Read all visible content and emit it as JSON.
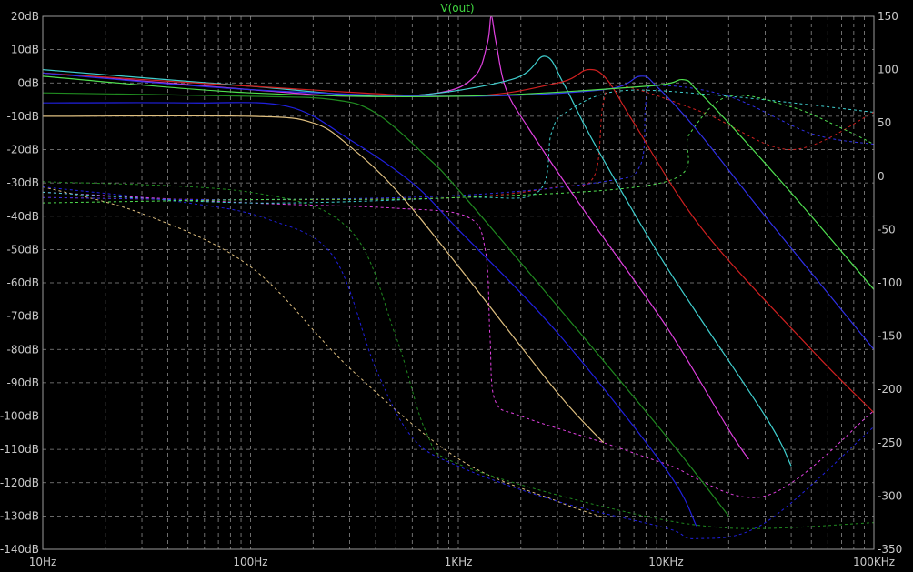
{
  "chart_data": {
    "type": "line",
    "title": "V(out)",
    "title_color": "#40d840",
    "background": "#000000",
    "grid": true,
    "grid_color": "#8a8a8a",
    "x_scale": "log",
    "xlim": [
      10,
      100000
    ],
    "x_ticks": [
      {
        "value": 10,
        "label": "10Hz"
      },
      {
        "value": 100,
        "label": "100Hz"
      },
      {
        "value": 1000,
        "label": "1KHz"
      },
      {
        "value": 10000,
        "label": "10KHz"
      },
      {
        "value": 100000,
        "label": "100KHz"
      }
    ],
    "ylim_left": [
      -140,
      20
    ],
    "left_unit": "dB",
    "y_ticks_left": [
      "20dB",
      "10dB",
      "0dB",
      "-10dB",
      "-20dB",
      "-30dB",
      "-40dB",
      "-50dB",
      "-60dB",
      "-70dB",
      "-80dB",
      "-90dB",
      "-100dB",
      "-110dB",
      "-120dB",
      "-130dB",
      "-140dB"
    ],
    "ylim_right": [
      -350,
      150
    ],
    "right_unit": "°",
    "y_ticks_right": [
      {
        "value": 150,
        "label": "150"
      },
      {
        "value": 100,
        "label": "100"
      },
      {
        "value": 50,
        "label": "50"
      },
      {
        "value": 0,
        "label": "0"
      },
      {
        "value": -50,
        "label": "-50"
      },
      {
        "value": -100,
        "label": "-100"
      },
      {
        "value": -150,
        "label": "-150"
      },
      {
        "value": -200,
        "label": "-200"
      },
      {
        "value": -250,
        "label": "-250"
      },
      {
        "value": -300,
        "label": "-300"
      },
      {
        "value": -350,
        "label": "-350"
      }
    ],
    "series": [
      {
        "color": "#e0c080",
        "style": "solid",
        "magnitude": [
          [
            10,
            -10
          ],
          [
            100,
            -10
          ],
          [
            200,
            -12
          ],
          [
            300,
            -19
          ],
          [
            500,
            -32
          ],
          [
            1000,
            -55
          ],
          [
            3000,
            -93
          ],
          [
            5000,
            -108
          ]
        ],
        "phase_style": "dashed",
        "phase": [
          [
            10,
            -10
          ],
          [
            30,
            -35
          ],
          [
            100,
            -85
          ],
          [
            300,
            -180
          ],
          [
            1000,
            -265
          ],
          [
            3000,
            -305
          ],
          [
            5000,
            -320
          ]
        ]
      },
      {
        "color": "#2020e0",
        "style": "solid",
        "magnitude": [
          [
            10,
            -6
          ],
          [
            50,
            -6
          ],
          [
            150,
            -7
          ],
          [
            300,
            -17
          ],
          [
            600,
            -30
          ],
          [
            1000,
            -44
          ],
          [
            3000,
            -75
          ],
          [
            10000,
            -116
          ],
          [
            14000,
            -133
          ]
        ],
        "phase_style": "dashed",
        "phase": [
          [
            10,
            -10
          ],
          [
            50,
            -25
          ],
          [
            120,
            -40
          ],
          [
            250,
            -75
          ],
          [
            400,
            -180
          ],
          [
            600,
            -245
          ],
          [
            1000,
            -272
          ],
          [
            3000,
            -305
          ],
          [
            10000,
            -330
          ],
          [
            14000,
            -340
          ],
          [
            30000,
            -325
          ],
          [
            100000,
            -235
          ]
        ]
      },
      {
        "color": "#208a20",
        "style": "solid",
        "magnitude": [
          [
            10,
            -3
          ],
          [
            100,
            -4
          ],
          [
            250,
            -5
          ],
          [
            400,
            -9
          ],
          [
            700,
            -22
          ],
          [
            1000,
            -32
          ],
          [
            3000,
            -67
          ],
          [
            10000,
            -106
          ],
          [
            20000,
            -130
          ]
        ],
        "phase_style": "dashed",
        "phase": [
          [
            10,
            -5
          ],
          [
            100,
            -15
          ],
          [
            300,
            -50
          ],
          [
            500,
            -150
          ],
          [
            700,
            -240
          ],
          [
            1000,
            -270
          ],
          [
            5000,
            -310
          ],
          [
            20000,
            -330
          ],
          [
            100000,
            -325
          ]
        ]
      },
      {
        "color": "#e040e0",
        "style": "solid",
        "magnitude": [
          [
            10,
            3
          ],
          [
            100,
            -2
          ],
          [
            300,
            -4
          ],
          [
            800,
            -3
          ],
          [
            1200,
            2
          ],
          [
            1380,
            12
          ],
          [
            1440,
            20
          ],
          [
            1520,
            12
          ],
          [
            1700,
            -2
          ],
          [
            2200,
            -14
          ],
          [
            4000,
            -38
          ],
          [
            10000,
            -73
          ],
          [
            20000,
            -104
          ],
          [
            25000,
            -113
          ]
        ],
        "phase_style": "dashed",
        "phase": [
          [
            10,
            -15
          ],
          [
            100,
            -25
          ],
          [
            500,
            -30
          ],
          [
            1100,
            -38
          ],
          [
            1350,
            -70
          ],
          [
            1420,
            -150
          ],
          [
            1500,
            -210
          ],
          [
            2000,
            -225
          ],
          [
            5000,
            -250
          ],
          [
            10000,
            -270
          ],
          [
            30000,
            -300
          ],
          [
            100000,
            -220
          ]
        ]
      },
      {
        "color": "#40d0d0",
        "style": "solid",
        "magnitude": [
          [
            10,
            4
          ],
          [
            100,
            -1
          ],
          [
            500,
            -4
          ],
          [
            1800,
            1
          ],
          [
            2600,
            8
          ],
          [
            3200,
            0
          ],
          [
            4500,
            -18
          ],
          [
            10000,
            -55
          ],
          [
            30000,
            -100
          ],
          [
            40000,
            -115
          ]
        ],
        "phase_style": "dashed",
        "phase": [
          [
            10,
            -15
          ],
          [
            100,
            -25
          ],
          [
            1000,
            -20
          ],
          [
            2400,
            -15
          ],
          [
            2800,
            40
          ],
          [
            3300,
            60
          ],
          [
            6000,
            80
          ],
          [
            20000,
            75
          ],
          [
            100000,
            60
          ]
        ]
      },
      {
        "color": "#d02020",
        "style": "solid",
        "magnitude": [
          [
            10,
            3
          ],
          [
            100,
            -1
          ],
          [
            1000,
            -4
          ],
          [
            3000,
            0
          ],
          [
            4200,
            4
          ],
          [
            5200,
            1
          ],
          [
            7000,
            -12
          ],
          [
            15000,
            -44
          ],
          [
            50000,
            -80
          ],
          [
            100000,
            -99
          ]
        ],
        "phase_style": "dashed",
        "phase": [
          [
            10,
            -20
          ],
          [
            100,
            -22
          ],
          [
            1000,
            -20
          ],
          [
            3000,
            -10
          ],
          [
            4500,
            0
          ],
          [
            5000,
            70
          ],
          [
            6000,
            85
          ],
          [
            15000,
            60
          ],
          [
            40000,
            25
          ],
          [
            100000,
            60
          ]
        ]
      },
      {
        "color": "#3030e8",
        "style": "solid",
        "magnitude": [
          [
            10,
            3
          ],
          [
            100,
            -2
          ],
          [
            1000,
            -4
          ],
          [
            5000,
            -2
          ],
          [
            7500,
            2
          ],
          [
            9000,
            -1
          ],
          [
            14000,
            -14
          ],
          [
            30000,
            -40
          ],
          [
            100000,
            -80
          ]
        ],
        "phase_style": "dashed",
        "phase": [
          [
            10,
            -20
          ],
          [
            100,
            -22
          ],
          [
            1000,
            -18
          ],
          [
            5000,
            -5
          ],
          [
            7500,
            10
          ],
          [
            8000,
            70
          ],
          [
            9000,
            85
          ],
          [
            20000,
            75
          ],
          [
            50000,
            40
          ],
          [
            100000,
            30
          ]
        ]
      },
      {
        "color": "#50e050",
        "style": "solid",
        "magnitude": [
          [
            10,
            2
          ],
          [
            100,
            -3
          ],
          [
            1000,
            -4
          ],
          [
            8000,
            -1
          ],
          [
            12000,
            1
          ],
          [
            14000,
            -2
          ],
          [
            20000,
            -12
          ],
          [
            40000,
            -33
          ],
          [
            100000,
            -62
          ]
        ],
        "phase_style": "dashed",
        "phase": [
          [
            10,
            -25
          ],
          [
            100,
            -22
          ],
          [
            1000,
            -20
          ],
          [
            10000,
            -5
          ],
          [
            13000,
            40
          ],
          [
            20000,
            75
          ],
          [
            40000,
            65
          ],
          [
            70000,
            45
          ],
          [
            100000,
            30
          ]
        ]
      }
    ]
  }
}
